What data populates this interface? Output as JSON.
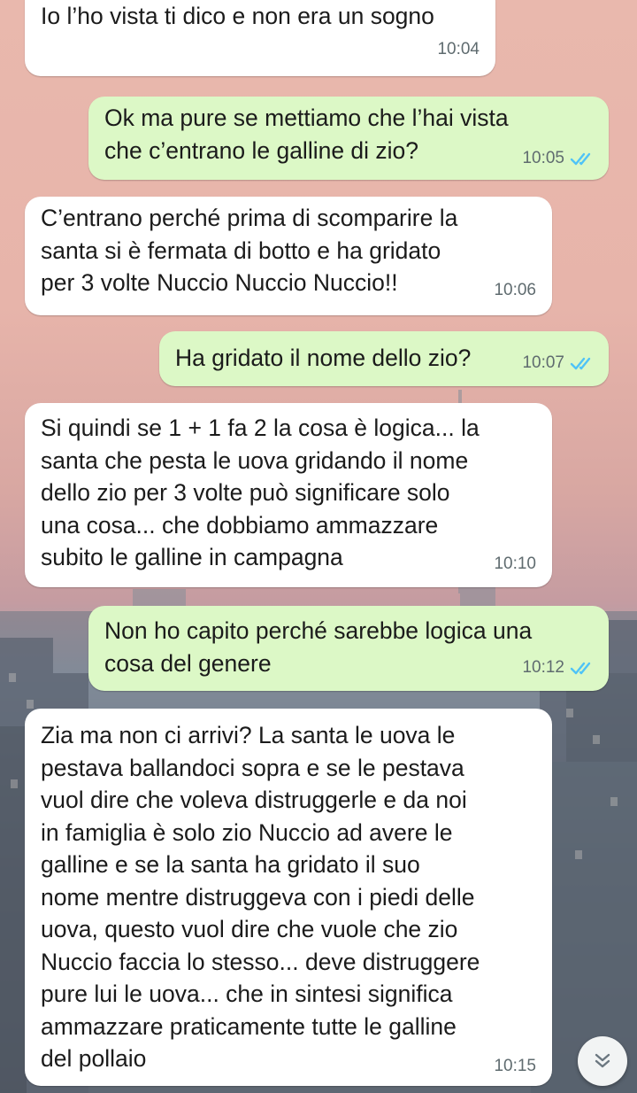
{
  "chat": {
    "messages": [
      {
        "direction": "in",
        "text": "Io l’ho vista ti dico e non era un sogno",
        "time": "10:04"
      },
      {
        "direction": "out",
        "text": "Ok ma pure se mettiamo che l’hai vista\nche c’entrano le galline di zio?",
        "time": "10:05",
        "status": "read"
      },
      {
        "direction": "in",
        "text": "C’entrano perché prima di scomparire la\nsanta si è fermata di botto e ha gridato\nper 3 volte Nuccio Nuccio Nuccio!!",
        "time": "10:06"
      },
      {
        "direction": "out",
        "text": "Ha gridato il nome dello zio?",
        "time": "10:07",
        "status": "read"
      },
      {
        "direction": "in",
        "text": "Si quindi se 1 + 1 fa 2 la cosa è logica... la\nsanta che pesta le uova gridando il nome\ndello zio per 3 volte può significare solo\nuna cosa... che dobbiamo ammazzare\nsubito le galline in campagna",
        "time": "10:10"
      },
      {
        "direction": "out",
        "text": "Non ho capito perché sarebbe logica una\ncosa del genere",
        "time": "10:12",
        "status": "read"
      },
      {
        "direction": "in",
        "text": "Zia ma non ci arrivi? La santa le uova le\npestava ballandoci sopra e se le pestava\nvuol dire che voleva distruggerle e da noi\nin famiglia è solo zio Nuccio ad avere le\ngalline e se la santa ha gridato il suo\nnome mentre distruggeva con i piedi delle\nuova, questo vuol dire che vuole che zio\nNuccio faccia lo stesso... deve distruggere\npure lui le uova... che in sintesi significa\nammazzare praticamente tutte le galline\ndel pollaio",
        "time": "10:15"
      }
    ]
  },
  "colors": {
    "incoming_bubble": "#ffffff",
    "outgoing_bubble": "#dcf8c6",
    "read_ticks": "#4fc3f7",
    "timestamp": "#5f6b6f"
  },
  "icons": {
    "read_receipt": "double-check-icon",
    "scroll_button": "double-chevron-down-icon"
  }
}
